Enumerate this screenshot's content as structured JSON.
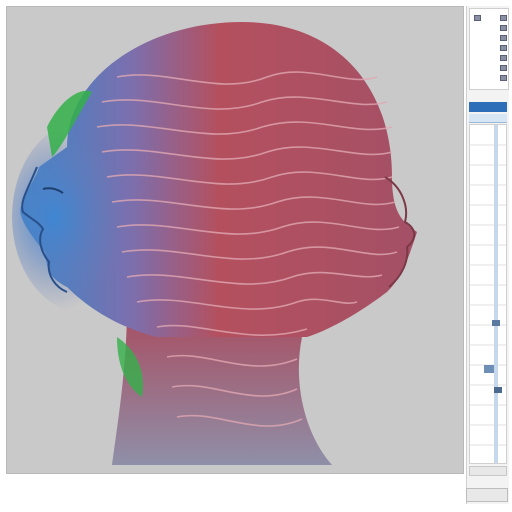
{
  "viewport": {
    "subject": "3d-head-model",
    "background_color": "#c9c9c9"
  },
  "colors": {
    "surface_red": "#b84a58",
    "surface_blue": "#4f7fc0",
    "surface_green": "#34b04a",
    "panel_accent": "#2c6fb8"
  },
  "panel": {
    "header": ""
  }
}
